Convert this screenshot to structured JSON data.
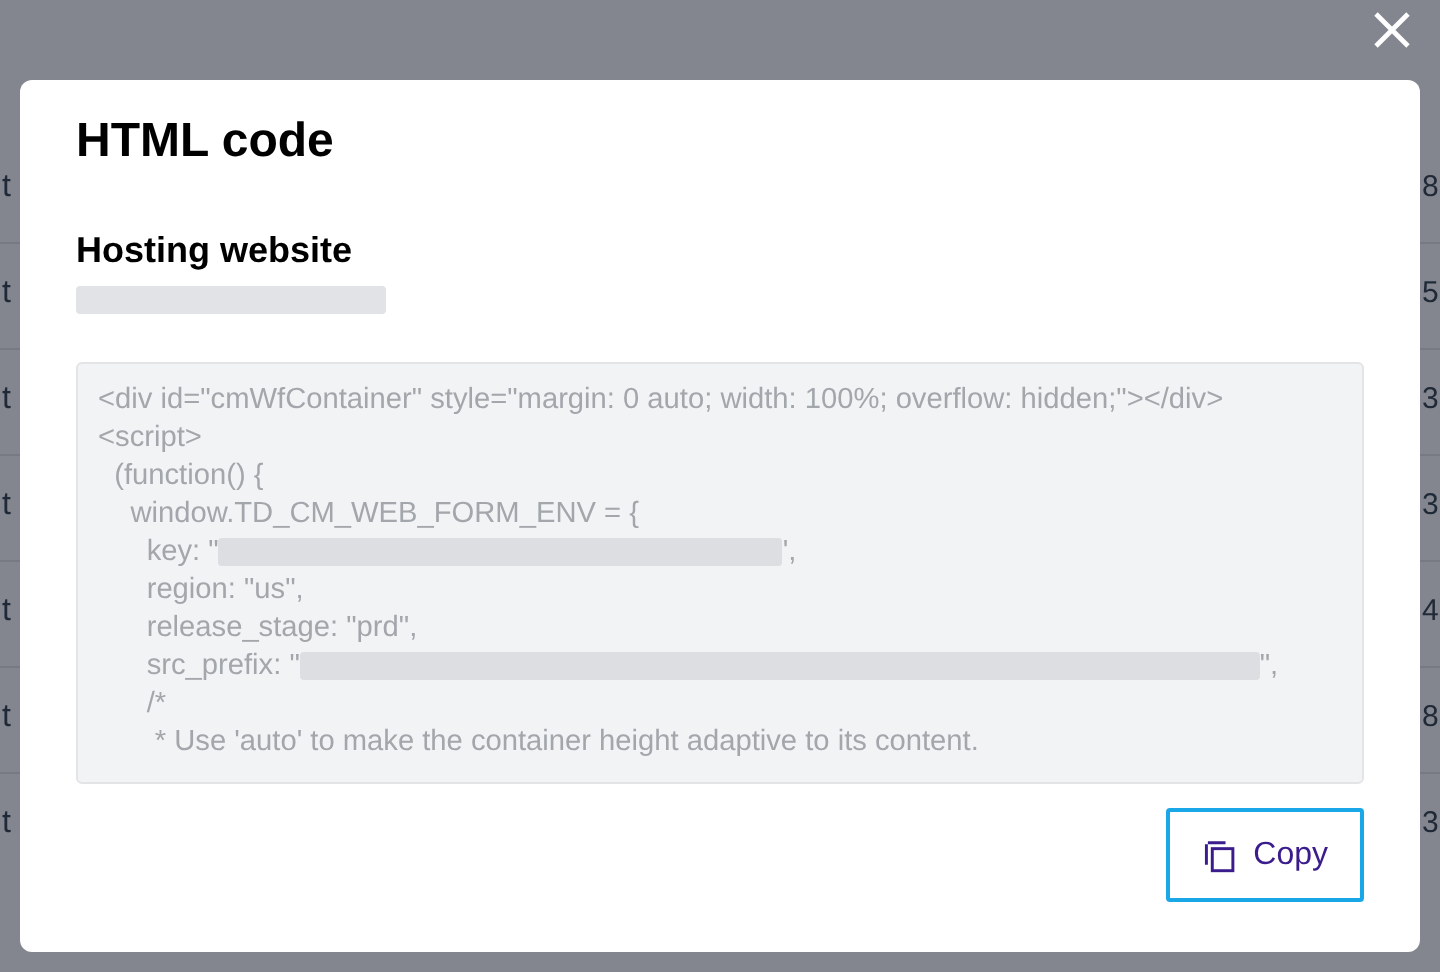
{
  "background_table": {
    "rows": [
      {
        "column_1": "t",
        "column_5": "8"
      },
      {
        "column_1": "t",
        "column_5": "5"
      },
      {
        "column_1": "t",
        "column_5": "3"
      },
      {
        "column_1": "t",
        "column_5": "3"
      },
      {
        "column_1": "t",
        "column_5": "4"
      },
      {
        "column_1": "t",
        "column_5": "8"
      },
      {
        "column_1": "t",
        "column_5": "3"
      }
    ]
  },
  "dialog": {
    "title": "HTML code",
    "section_label": "Hosting website",
    "value_redacted": true,
    "code_lines": [
      {
        "text": "<div id=\"cmWfContainer\" style=\"margin: 0 auto; width: 100%; overflow: hidden;\"></div>"
      },
      {
        "text": "<script>"
      },
      {
        "text": "  (function() {"
      },
      {
        "text": "    window.TD_CM_WEB_FORM_ENV = {"
      },
      {
        "text": "      key: \"",
        "redacted": true,
        "tail": "',"
      },
      {
        "text": "      region: \"us\","
      },
      {
        "text": "      release_stage: \"prd\","
      },
      {
        "text": "      src_prefix: \"",
        "redacted": true,
        "tail": "\","
      },
      {
        "text": "      /*"
      },
      {
        "text": "       * Use 'auto' to make the container height adaptive to its content."
      }
    ],
    "copy_button": {
      "label": "Copy",
      "focused": true
    }
  }
}
